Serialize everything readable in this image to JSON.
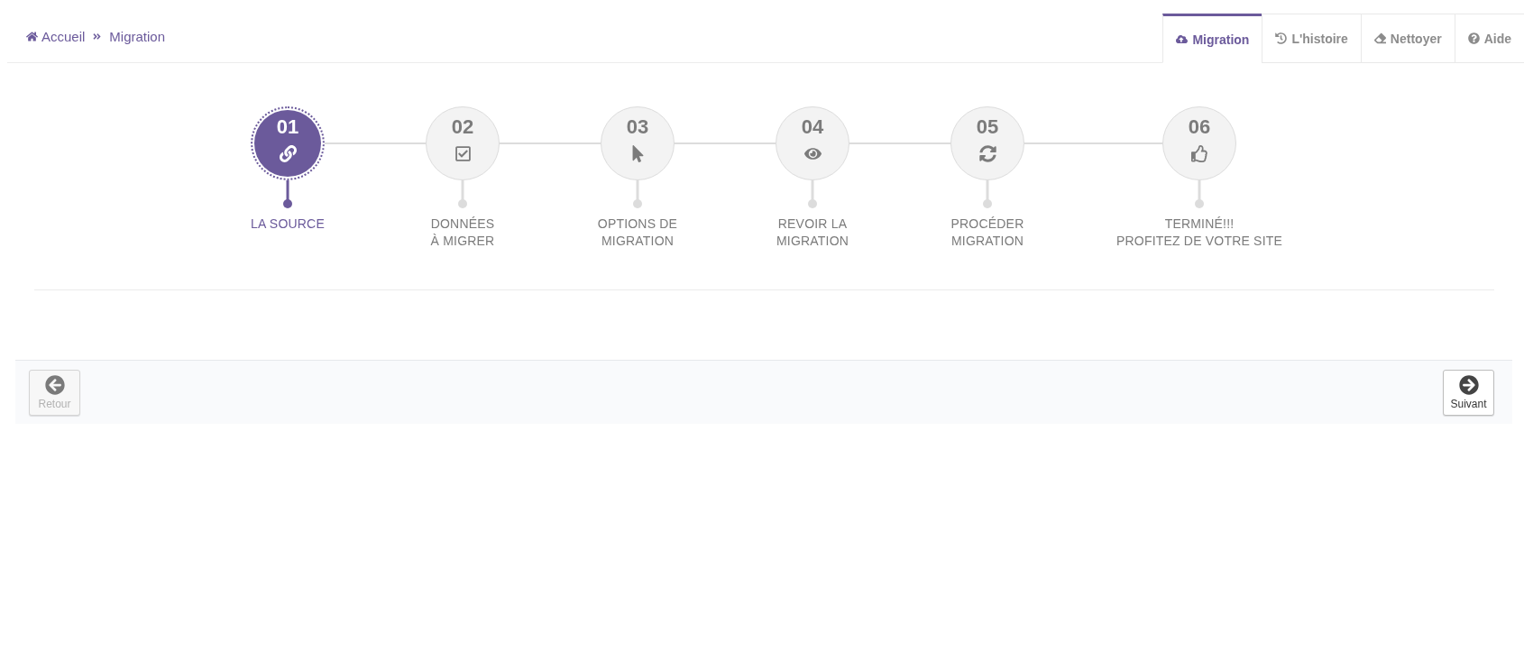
{
  "breadcrumb": [
    "Accueil",
    "Migration"
  ],
  "tabs": [
    {
      "label": "Migration",
      "selected": true
    },
    {
      "label": "L'histoire",
      "selected": false
    },
    {
      "label": "Nettoyer",
      "selected": false
    },
    {
      "label": "Aide",
      "selected": false
    }
  ],
  "steps": [
    {
      "number": "01",
      "label": "LA SOURCE",
      "active": true
    },
    {
      "number": "02",
      "label": "DONNÉES\nÀ MIGRER",
      "active": false
    },
    {
      "number": "03",
      "label": "OPTIONS DE\nMIGRATION",
      "active": false
    },
    {
      "number": "04",
      "label": "REVOIR LA\nMIGRATION",
      "active": false
    },
    {
      "number": "05",
      "label": "PROCÉDER\nMIGRATION",
      "active": false
    },
    {
      "number": "06",
      "label": "TERMINÉ!!!\nPROFITEZ DE VOTRE SITE",
      "active": false
    }
  ],
  "footer": {
    "buttons": [
      {
        "label": "Retour",
        "disabled": true
      },
      {
        "label": "Suivant",
        "disabled": false
      }
    ]
  }
}
